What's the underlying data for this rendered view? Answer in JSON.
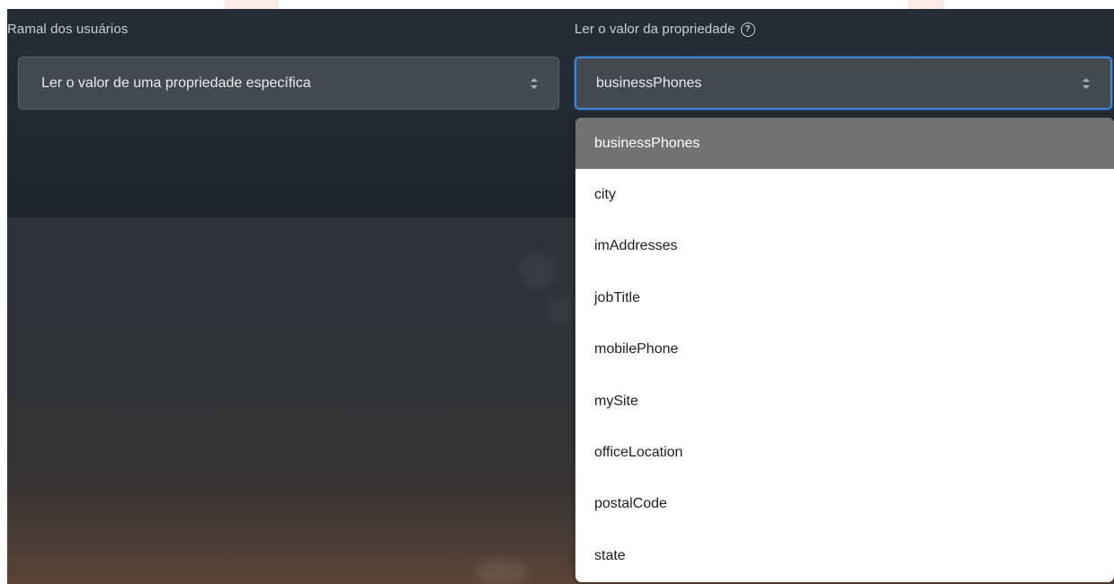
{
  "left_field": {
    "label": "Ramal dos usuários",
    "value": "Ler o valor de uma propriedade específica"
  },
  "right_field": {
    "label": "Ler o valor da propriedade",
    "help_icon": "question-circle-icon",
    "value": "businessPhones"
  },
  "dropdown": {
    "selected_index": 0,
    "options": [
      "businessPhones",
      "city",
      "imAddresses",
      "jobTitle",
      "mobilePhone",
      "mySite",
      "officeLocation",
      "postalCode",
      "state"
    ]
  },
  "colors": {
    "focus_border": "#3f86d8",
    "selected_option_bg": "#727272",
    "select_bg": "#424950"
  }
}
